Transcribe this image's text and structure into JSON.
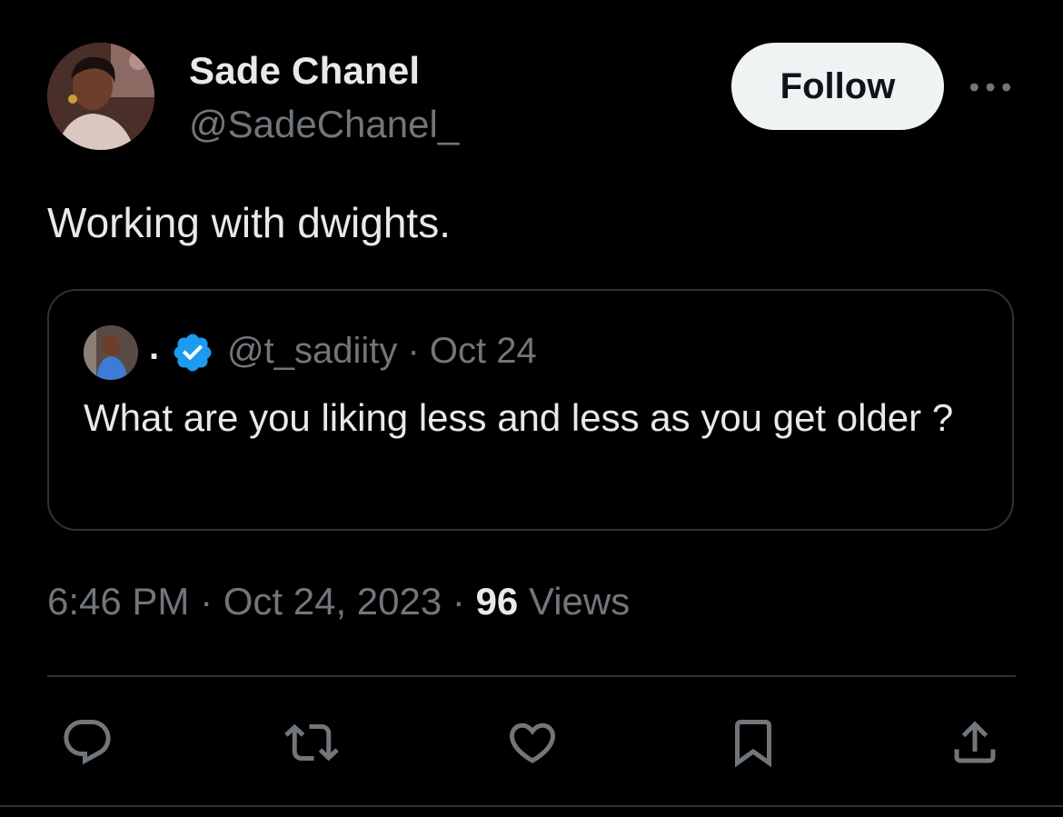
{
  "author": {
    "display_name": "Sade Chanel",
    "handle": "@SadeChanel_",
    "avatar_icon": "profile-photo"
  },
  "follow_label": "Follow",
  "more_icon": "more-horizontal-icon",
  "tweet": {
    "text": "Working with dwights."
  },
  "quote": {
    "name": ".",
    "verified_icon": "verified-badge-icon",
    "handle_date": "@t_sadiity · Oct 24",
    "text": "What are you liking less and less as you get older ?"
  },
  "meta": {
    "time": "6:46 PM",
    "separator1": " · ",
    "date": "Oct 24, 2023",
    "separator2": " · ",
    "views_count": "96",
    "views_label": " Views"
  },
  "actions": [
    {
      "icon": "reply-icon"
    },
    {
      "icon": "retweet-icon"
    },
    {
      "icon": "like-icon"
    },
    {
      "icon": "bookmark-icon"
    },
    {
      "icon": "share-icon"
    }
  ],
  "colors": {
    "background": "#000000",
    "text_primary": "#e7e9ea",
    "text_secondary": "#71767b",
    "border": "#2f3336",
    "follow_bg": "#eff3f4",
    "verified_blue": "#1d9bf0"
  }
}
